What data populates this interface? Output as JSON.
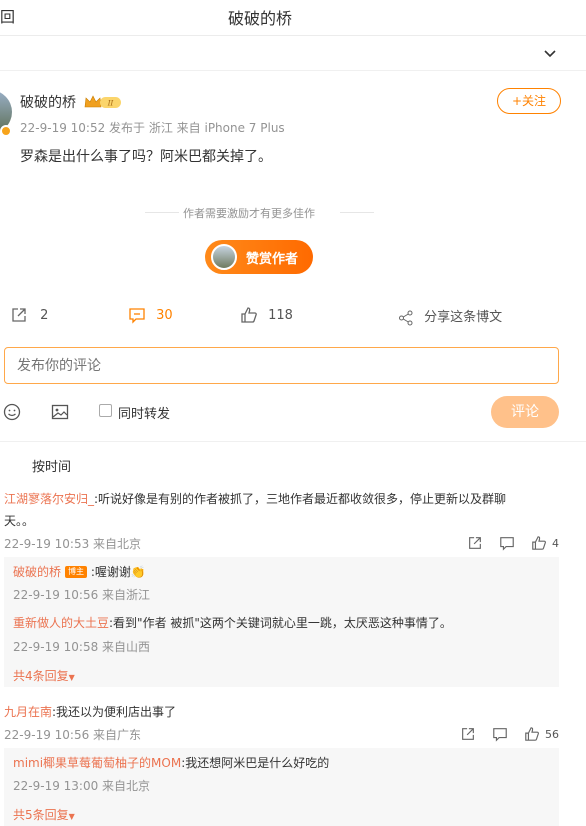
{
  "header": {
    "back_label": "回",
    "title": "破破的桥"
  },
  "post": {
    "author": "破破的桥",
    "level_badge": "II",
    "follow_label": "+关注",
    "meta": "22-9-19 10:52  发布于 浙江  来自 iPhone 7 Plus",
    "text": "罗森是出什么事了吗？阿米巴都关掉了。",
    "reward_hint": "作者需要激励才有更多佳作",
    "reward_button": "赞赏作者",
    "forward_count": "2",
    "comment_count": "30",
    "like_count": "118",
    "share_label": "分享这条博文"
  },
  "composer": {
    "placeholder": "发布你的评论",
    "repost_label": "同时转发",
    "submit_label": "评论"
  },
  "sort_label": "按时间",
  "comments": [
    {
      "user": "江湖寥落尔安归_",
      "text": ":听说好像是有别的作者被抓了，三地作者最近都收敛很多，停止更新以及群聊",
      "text_cont": "天。。",
      "meta": "22-9-19 10:53 来自北京",
      "likes": "4",
      "replies": [
        {
          "user": "破破的桥",
          "tag": "博主",
          "text": ":喔谢谢",
          "meta": "22-9-19 10:56 来自浙江"
        },
        {
          "user": "重新做人的大土豆",
          "text": ":看到\"作者 被抓\"这两个关键词就心里一跳，太厌恶这种事情了。",
          "meta": "22-9-19 10:58 来自山西"
        }
      ],
      "more_label": "共4条回复"
    },
    {
      "user": "九月在南",
      "text": ":我还以为便利店出事了",
      "meta": "22-9-19 10:56 来自广东",
      "likes": "56",
      "replies": [
        {
          "user": "mimi椰果草莓葡萄柚子的MOM",
          "text": ":我还想阿米巴是什么好吃的",
          "meta": "22-9-19 13:00 来自北京"
        }
      ],
      "more_label": "共5条回复"
    }
  ],
  "colors": {
    "accent": "#ff8200",
    "link": "#eb7350",
    "muted": "#939393"
  }
}
